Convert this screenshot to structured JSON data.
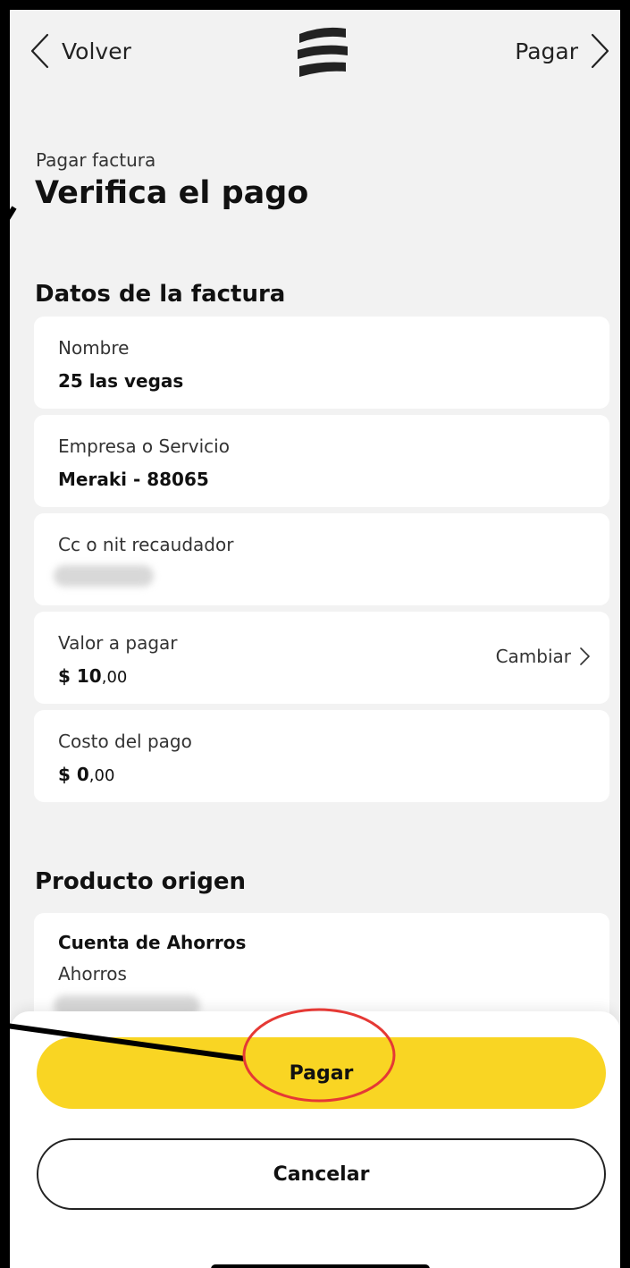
{
  "header": {
    "back_label": "Volver",
    "next_label": "Pagar"
  },
  "page": {
    "subtitle": "Pagar factura",
    "title": "Verifica el pago"
  },
  "invoice_section": {
    "title": "Datos de la factura",
    "fields": [
      {
        "label": "Nombre",
        "value": "25 las vegas"
      },
      {
        "label": "Empresa o Servicio",
        "value": "Meraki - 88065"
      },
      {
        "label": "Cc o nit recaudador",
        "value": ""
      },
      {
        "label": "Valor a pagar",
        "value_main": "$ 10",
        "value_cents": ",00",
        "action": "Cambiar"
      },
      {
        "label": "Costo del pago",
        "value_main": "$ 0",
        "value_cents": ",00"
      }
    ]
  },
  "source_section": {
    "title": "Producto origen",
    "account_name": "Cuenta de Ahorros",
    "account_type": "Ahorros"
  },
  "actions": {
    "pay_label": "Pagar",
    "cancel_label": "Cancelar"
  },
  "colors": {
    "accent": "#f9d523",
    "annotation": "#e53935"
  }
}
